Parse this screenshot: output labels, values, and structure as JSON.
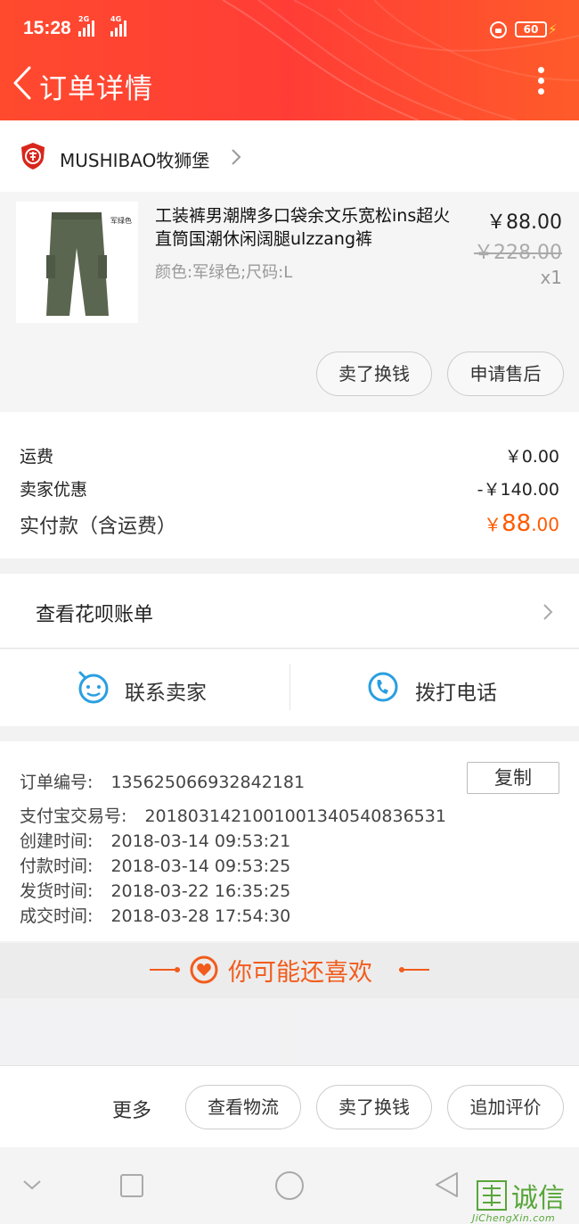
{
  "status_bar": {
    "time": "15:28",
    "signal_1": "2G",
    "signal_2": "4G",
    "battery": "60"
  },
  "header": {
    "title": "订单详情",
    "back_icon": "chevron-left-icon",
    "menu_icon": "more-vertical-icon"
  },
  "shop": {
    "name": "MUSHIBAO牧狮堡",
    "logo_icon": "shop-shield-icon"
  },
  "product": {
    "title": "工装裤男潮牌多口袋余文乐宽松ins超火直筒国潮休闲阔腿ulzzang裤",
    "spec": "颜色:军绿色;尺码:L",
    "price": "￥88.00",
    "original_price": "￥228.00",
    "quantity": "x1",
    "image_tag": "军绿色",
    "buttons": [
      "卖了换钱",
      "申请售后"
    ]
  },
  "fees": {
    "shipping_label": "运费",
    "shipping_value": "￥0.00",
    "discount_label": "卖家优惠",
    "discount_value": "-￥140.00",
    "paid_label": "实付款（含运费）",
    "paid_symbol": "￥",
    "paid_integer": "88",
    "paid_decimal": ".00"
  },
  "huabei": {
    "label": "查看花呗账单"
  },
  "contact": {
    "seller_label": "联系卖家",
    "phone_label": "拨打电话"
  },
  "order_info": {
    "copy_label": "复制",
    "rows": [
      {
        "key": "订单编号:",
        "value": "135625066932842181"
      },
      {
        "key": "支付宝交易号:",
        "value": "2018031421001001340540836531"
      },
      {
        "key": "创建时间:",
        "value": "2018-03-14 09:53:21"
      },
      {
        "key": "付款时间:",
        "value": "2018-03-14 09:53:25"
      },
      {
        "key": "发货时间:",
        "value": "2018-03-22 16:35:25"
      },
      {
        "key": "成交时间:",
        "value": "2018-03-28 17:54:30"
      }
    ]
  },
  "recommend": {
    "title": "你可能还喜欢"
  },
  "action_bar": {
    "more_label": "更多",
    "buttons": [
      "查看物流",
      "卖了换钱",
      "追加评价"
    ]
  },
  "watermark": {
    "text": "诚信",
    "url_text": "JiChengXin.com"
  },
  "colors": {
    "header": "#ff4a2e",
    "accent": "#ff5a00",
    "recommend": "#f25c1c",
    "contact_icon": "#2a9fe0"
  }
}
